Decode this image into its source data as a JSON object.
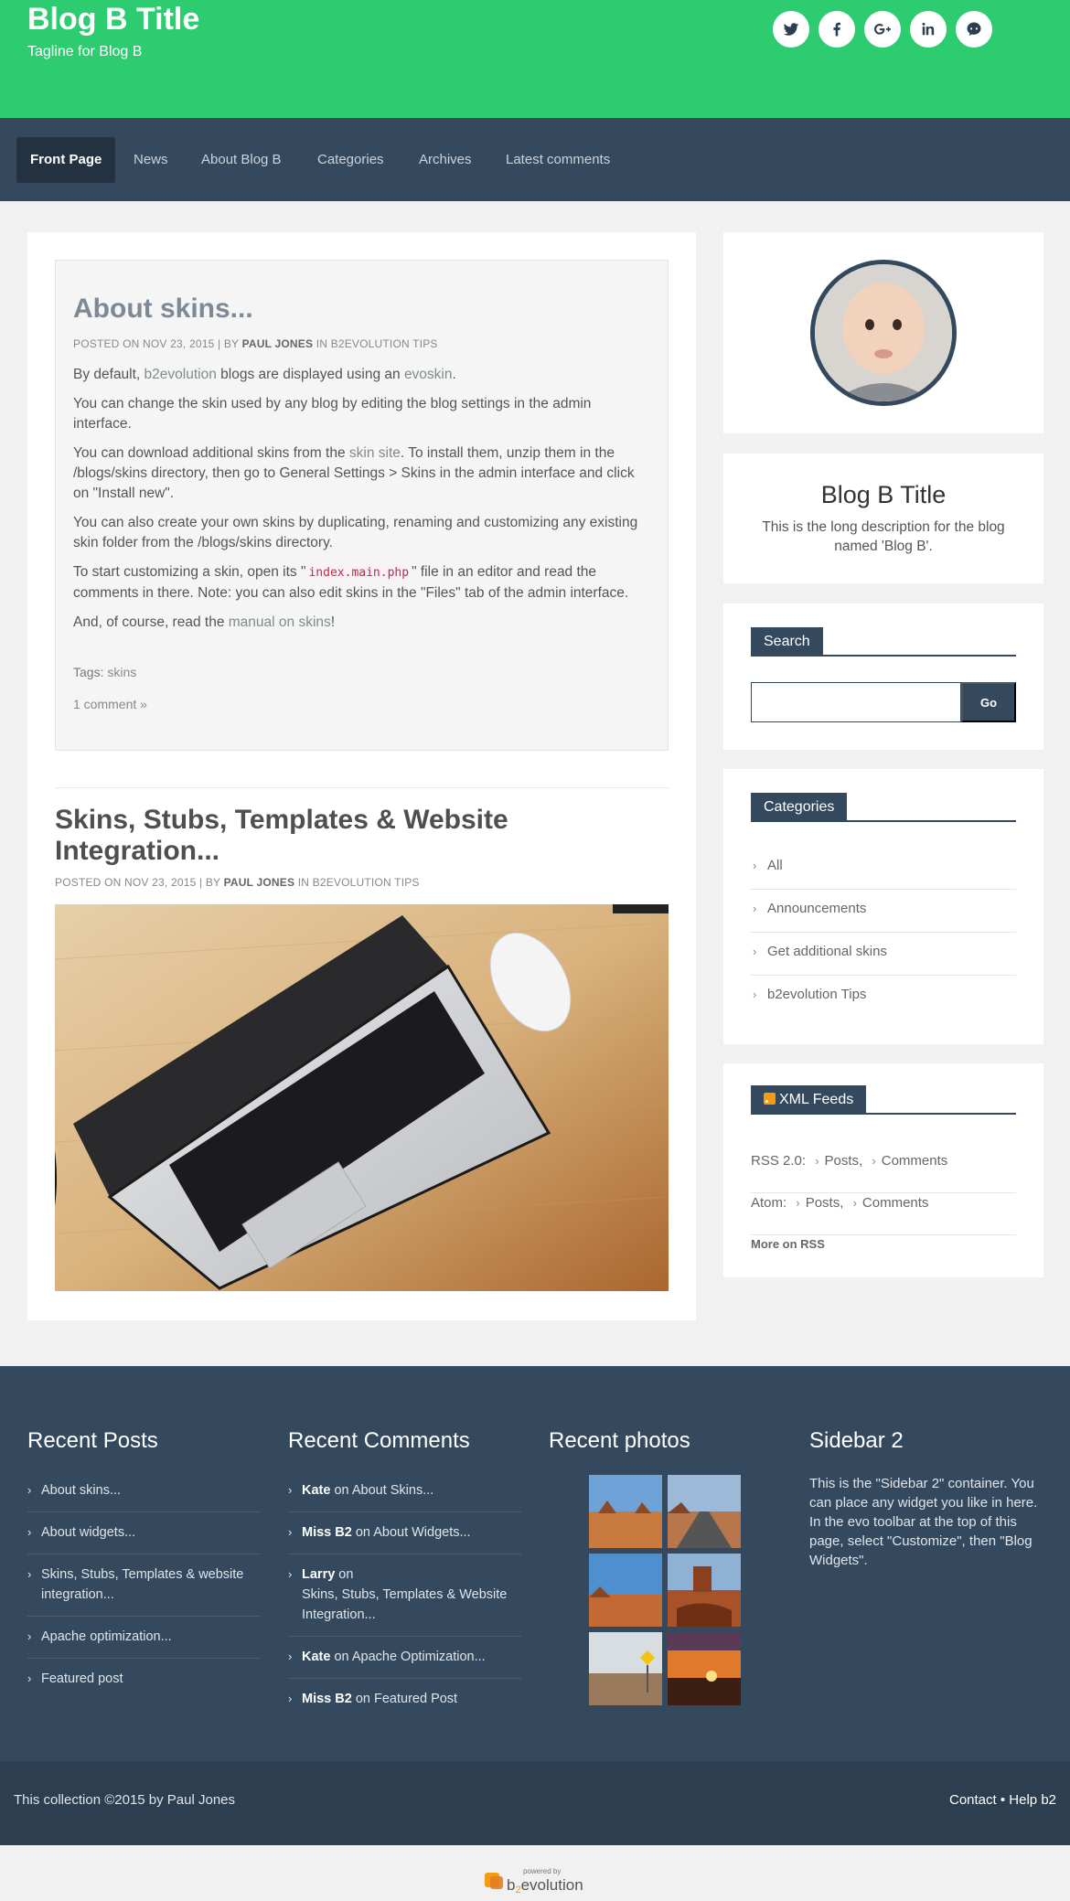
{
  "header": {
    "title": "Blog B Title",
    "tagline": "Tagline for Blog B",
    "social": [
      "twitter-icon",
      "facebook-icon",
      "google-plus-icon",
      "linkedin-icon",
      "github-icon"
    ],
    "colors": {
      "header_bg": "#2ecc71",
      "nav_bg": "#34495e",
      "accent": "#34495e"
    }
  },
  "nav": {
    "items": [
      "Front Page",
      "News",
      "About Blog B",
      "Categories",
      "Archives",
      "Latest comments"
    ],
    "active": "Front Page"
  },
  "post1": {
    "title": "About skins...",
    "meta_posted": "POSTED ON NOV 23, 2015 | BY ",
    "meta_author": "PAUL JONES",
    "meta_in": " IN B2EVOLUTION TIPS",
    "p1_a": "By default, ",
    "p1_link1": "b2evolution",
    "p1_b": " blogs are displayed using an ",
    "p1_link2": "evoskin",
    "p1_c": ".",
    "p2": "You can change the skin used by any blog by editing the blog settings in the admin interface.",
    "p3_a": "You can download additional skins from the ",
    "p3_link": "skin site",
    "p3_b": ". To install them, unzip them in the /blogs/skins directory, then go to General Settings > Skins in the admin interface and click on \"Install new\".",
    "p4": "You can also create your own skins by duplicating, renaming and customizing any existing skin folder from the /blogs/skins directory.",
    "p5_a": "To start customizing a skin, open its \"",
    "p5_code": "index.main.php",
    "p5_b": "\" file in an editor and read the comments in there. Note: you can also edit skins in the \"Files\" tab of the admin interface.",
    "p6_a": "And, of course, read the ",
    "p6_link": "manual on skins",
    "p6_b": "!",
    "tags_label": "Tags: ",
    "tag": "skins",
    "comments": "1 comment »"
  },
  "post2": {
    "title": "Skins, Stubs, Templates & Website Integration...",
    "meta_posted": "POSTED ON NOV 23, 2015 | BY ",
    "meta_author": "PAUL JONES",
    "meta_in": " IN B2EVOLUTION TIPS"
  },
  "sidebar": {
    "bio_title": "Blog B Title",
    "bio_desc": "This is the long description for the blog named 'Blog B'.",
    "search_title": "Search",
    "search_placeholder": "",
    "search_button": "Go",
    "categories_title": "Categories",
    "categories": [
      "All",
      "Announcements",
      "Get additional skins",
      "b2evolution Tips"
    ],
    "feeds_title": "XML Feeds",
    "rss_label": "RSS 2.0:",
    "atom_label": "Atom:",
    "posts": "Posts,",
    "comments": "Comments",
    "more_rss": "More on RSS"
  },
  "footer": {
    "recent_posts_title": "Recent Posts",
    "recent_posts": [
      "About skins...",
      "About widgets...",
      "Skins, Stubs, Templates & website integration...",
      "Apache optimization...",
      "Featured post"
    ],
    "recent_comments_title": "Recent Comments",
    "recent_comments": [
      {
        "author": "Kate",
        "on": " on ",
        "post": "About Skins..."
      },
      {
        "author": "Miss B2",
        "on": " on ",
        "post": "About Widgets..."
      },
      {
        "author": "Larry",
        "on": " on",
        "post": "Skins, Stubs, Templates & Website Integration..."
      },
      {
        "author": "Kate",
        "on": " on ",
        "post": "Apache Optimization..."
      },
      {
        "author": "Miss B2",
        "on": " on ",
        "post": "Featured Post"
      }
    ],
    "recent_photos_title": "Recent photos",
    "sidebar2_title": "Sidebar 2",
    "sidebar2_text": "This is the \"Sidebar 2\" container. You can place any widget you like in here. In the evo toolbar at the top of this page, select \"Customize\", then \"Blog Widgets\".",
    "copyright": "This collection ©2015 by Paul Jones",
    "contact": "Contact",
    "bullet": " • ",
    "help": "Help b2",
    "powered_by": "powered by",
    "brand_b": "b",
    "brand_2": "2",
    "brand_rest": "evolution"
  }
}
